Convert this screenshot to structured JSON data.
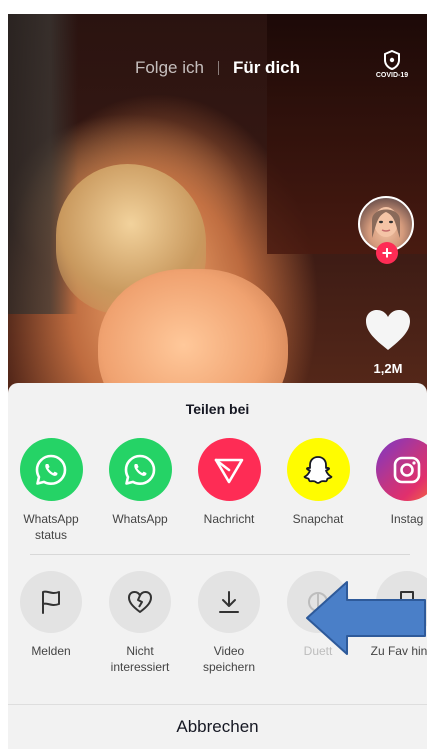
{
  "header": {
    "tab_following": "Folge ich",
    "tab_for_you": "Für dich",
    "covid_label": "COVID-19"
  },
  "rail": {
    "like_count": "1,2M",
    "follow_plus": "+"
  },
  "share_sheet": {
    "title": "Teilen bei",
    "share_targets": [
      {
        "label": "WhatsApp status",
        "icon": "whatsapp-icon",
        "color": "#25d366"
      },
      {
        "label": "WhatsApp",
        "icon": "whatsapp-icon",
        "color": "#25d366"
      },
      {
        "label": "Nachricht",
        "icon": "send-icon",
        "color": "#fe2c55"
      },
      {
        "label": "Snapchat",
        "icon": "snapchat-ghost-icon",
        "color": "#fffc00"
      },
      {
        "label": "Instag",
        "icon": "instagram-icon",
        "color": "#c13584"
      }
    ],
    "actions": [
      {
        "label": "Melden",
        "icon": "flag-icon"
      },
      {
        "label": "Nicht interessiert",
        "icon": "broken-heart-icon"
      },
      {
        "label": "Video speichern",
        "icon": "download-icon"
      },
      {
        "label": "Duett",
        "icon": "duet-icon"
      },
      {
        "label": "Zu Fav hinzuf",
        "icon": "bookmark-icon"
      }
    ],
    "cancel_label": "Abbrechen"
  },
  "annotation": {
    "arrow_color": "#4a7fc8"
  }
}
